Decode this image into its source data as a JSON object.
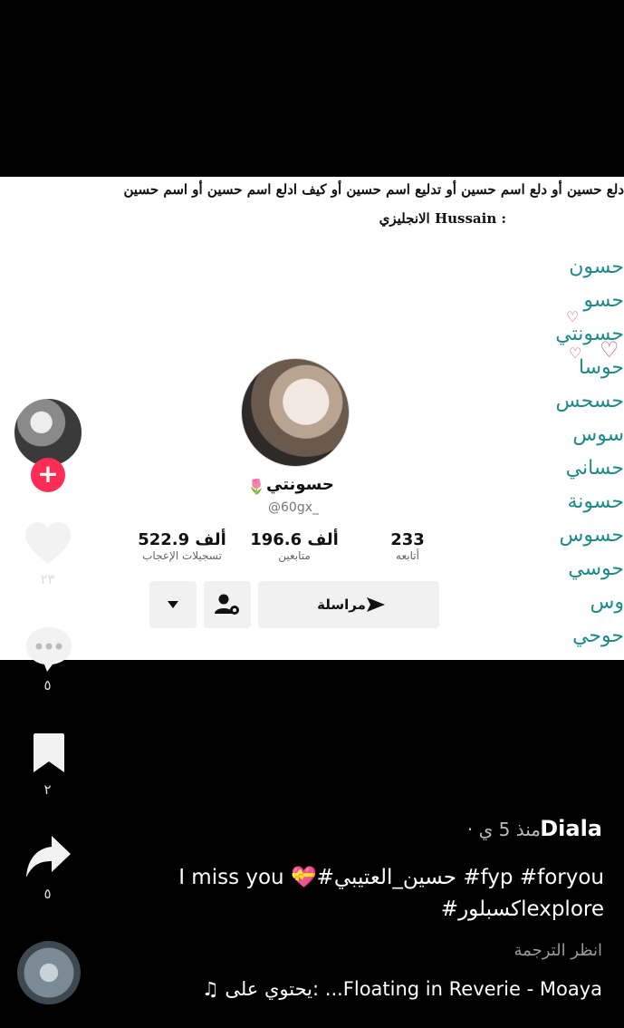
{
  "video": {
    "top_text_line1": "دلع حسين أو دلع اسم حسين أو تدليع اسم حسين أو كيف ادلع اسم حسين أو اسم حسين",
    "top_text_line2": "الانجليزي Hussain :",
    "nicknames": [
      "حسون",
      "حسو",
      "حسونتي",
      "حوسا",
      "حسحس",
      "سوس",
      "حساني",
      "حسونة",
      "حسوس",
      "حوسي",
      "وس",
      "حوحي"
    ],
    "profile": {
      "name": "حسونتي",
      "handle": "@60gx_",
      "stats": [
        {
          "value": "522.9 ألف",
          "label": "تسجيلات الإعجاب"
        },
        {
          "value": "196.6 ألف",
          "label": "متابعين"
        },
        {
          "value": "233",
          "label": "أتابعه"
        }
      ],
      "message_label": "مراسلة"
    }
  },
  "sidebar": {
    "likes_count": "٢٣",
    "comments_count": "٥",
    "saves_count": "٢",
    "shares_count": "٥"
  },
  "caption": {
    "username": "Diala",
    "time": "منذ 5 ي ·",
    "line1": "I miss you 💝#حسين_العتيبي #fyp #foryou",
    "line2": "#اكسبلورexplore",
    "translate": "انظر الترجمة",
    "music": "♫ يحتوي على: ...Floating in Reverie - Moaya"
  },
  "colors": {
    "accent": "#ff2c55",
    "nick_teal": "#1f8a8a"
  }
}
